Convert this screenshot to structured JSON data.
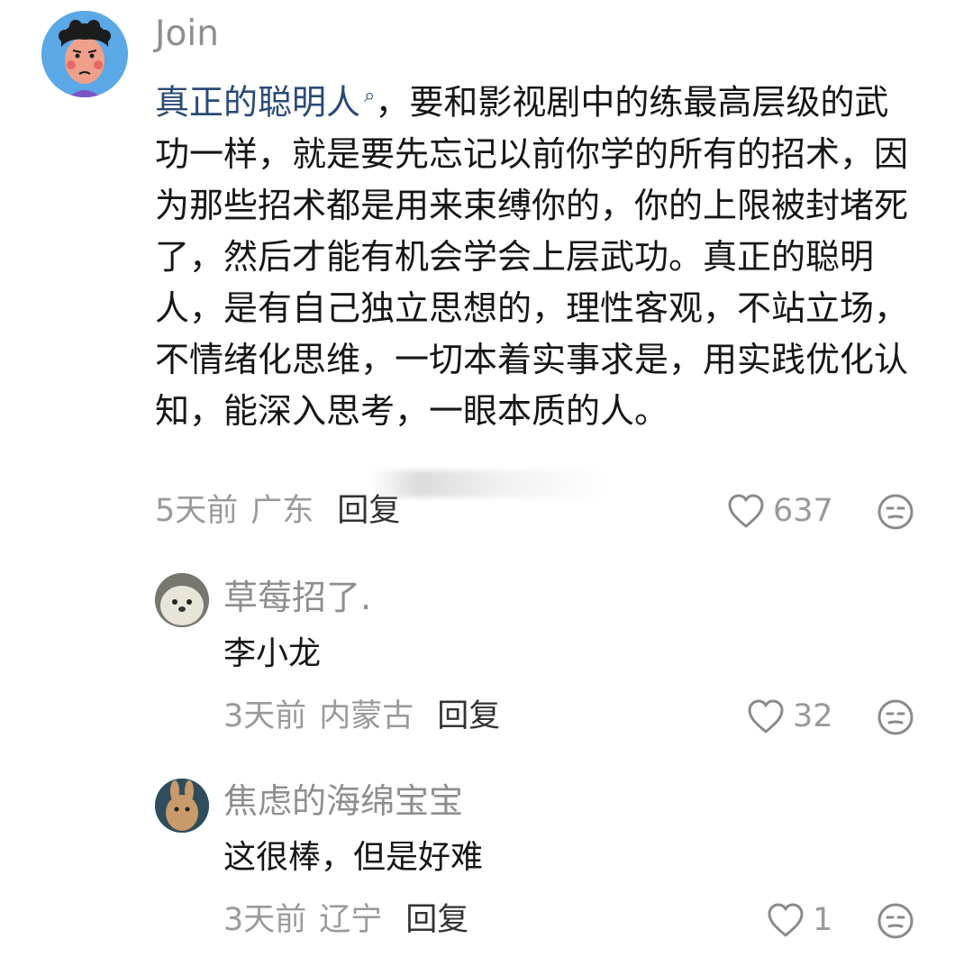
{
  "comments": [
    {
      "username": "Join",
      "link_text": "真正的聪明人",
      "text": "，要和影视剧中的练最高层级的武功一样，就是要先忘记以前你学的所有的招术，因为那些招术都是用来束缚你的，你的上限被封堵死了，然后才能有机会学会上层武功。真正的聪明人，是有自己独立思想的，理性客观，不站立场，不情绪化思维，一切本着实事求是，用实践优化认知，能深入思考，一眼本质的人。",
      "time": "5天前",
      "location": "广东",
      "reply_label": "回复",
      "likes": "637"
    }
  ],
  "replies": [
    {
      "username": "草莓招了.",
      "text": "李小龙",
      "time": "3天前",
      "location": "内蒙古",
      "reply_label": "回复",
      "likes": "32"
    },
    {
      "username": "焦虑的海绵宝宝",
      "text": "这很棒，但是好难",
      "time": "3天前",
      "location": "辽宁",
      "reply_label": "回复",
      "likes": "1"
    }
  ],
  "icons": {
    "like": "heart-outline-icon",
    "dislike": "meh-face-icon",
    "search": "search-icon"
  },
  "colors": {
    "link": "#2a4a74",
    "meta": "#9a9a9a",
    "avatar_bg": "#5aa8e6"
  }
}
